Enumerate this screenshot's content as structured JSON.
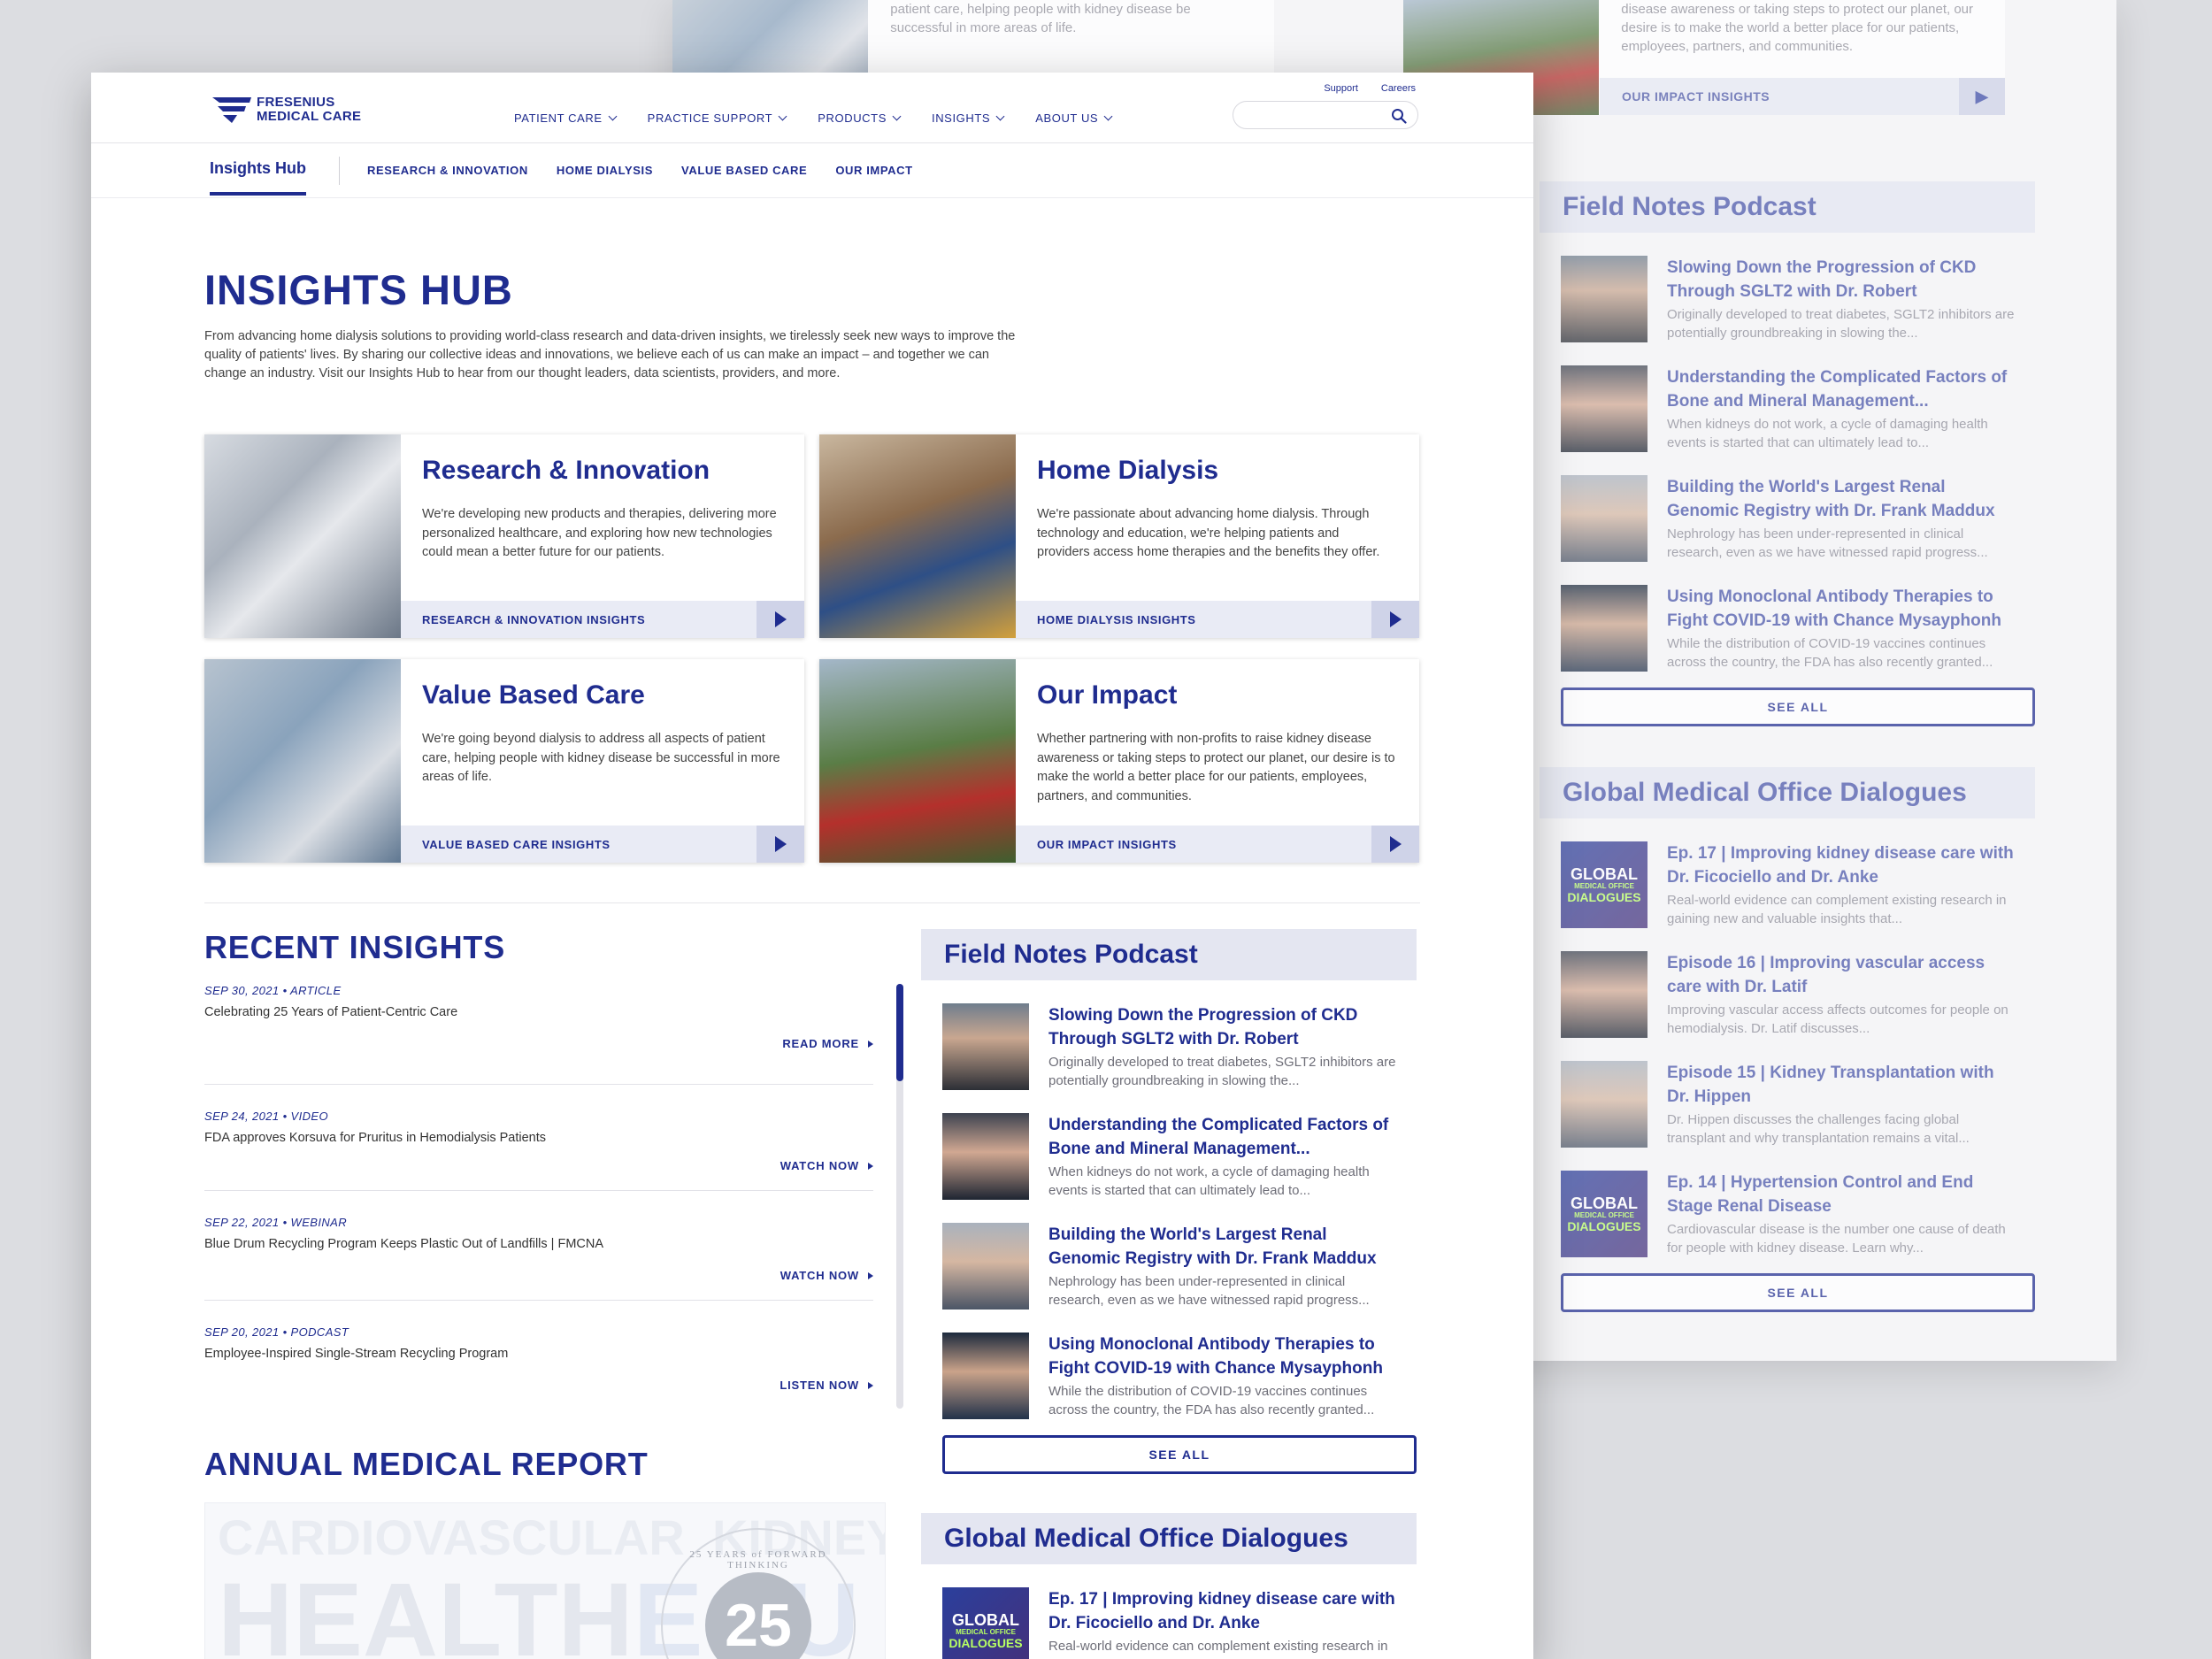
{
  "brand": {
    "line1": "FRESENIUS",
    "line2": "MEDICAL CARE",
    "color": "#1f2c8f"
  },
  "utility": {
    "support": "Support",
    "careers": "Careers"
  },
  "nav": [
    "PATIENT CARE",
    "PRACTICE SUPPORT",
    "PRODUCTS",
    "INSIGHTS",
    "ABOUT US"
  ],
  "search": {
    "placeholder": ""
  },
  "subnav": {
    "current": "Insights Hub",
    "links": [
      "RESEARCH & INNOVATION",
      "HOME DIALYSIS",
      "VALUE BASED CARE",
      "OUR IMPACT"
    ]
  },
  "hero": {
    "title": "INSIGHTS HUB",
    "description": "From advancing home dialysis solutions to providing world-class research and data-driven insights, we tirelessly seek new ways to improve the quality of patients' lives. By sharing our collective ideas and innovations, we believe each of us can make an impact – and together we can change an industry. Visit our Insights Hub to hear from our thought leaders, data scientists, providers, and more."
  },
  "cards": [
    {
      "title": "Research & Innovation",
      "body": "We're developing new products and therapies, delivering more personalized healthcare, and exploring how new technologies could mean a better future for our patients.",
      "link": "RESEARCH & INNOVATION INSIGHTS"
    },
    {
      "title": "Home Dialysis",
      "body": "We're passionate about advancing home dialysis. Through technology and education, we're helping patients and providers access home therapies and the benefits they offer.",
      "link": "HOME DIALYSIS INSIGHTS"
    },
    {
      "title": "Value Based Care",
      "body": "We're going beyond dialysis to address all aspects of patient care, helping people with kidney disease be successful in more areas of life.",
      "link": "VALUE BASED CARE INSIGHTS"
    },
    {
      "title": "Our Impact",
      "body": "Whether partnering with non-profits to raise kidney disease awareness or taking steps to protect our planet, our desire is to make the world a better place for our patients, employees, partners, and communities.",
      "link": "OUR IMPACT INSIGHTS"
    }
  ],
  "recent": {
    "title": "RECENT INSIGHTS",
    "items": [
      {
        "date": "SEP 30, 2021",
        "type": "ARTICLE",
        "headline": "Celebrating 25 Years of Patient-Centric Care",
        "action": "READ MORE"
      },
      {
        "date": "SEP 24, 2021",
        "type": "VIDEO",
        "headline": "FDA approves Korsuva for Pruritus in Hemodialysis Patients",
        "action": "WATCH NOW"
      },
      {
        "date": "SEP 22, 2021",
        "type": "WEBINAR",
        "headline": "Blue Drum Recycling Program Keeps Plastic Out of Landfills | FMCNA",
        "action": "WATCH NOW"
      },
      {
        "date": "SEP 20, 2021",
        "type": "PODCAST",
        "headline": "Employee-Inspired Single-Stream Recycling Program",
        "action": "LISTEN NOW"
      }
    ],
    "separator": "•"
  },
  "annual": {
    "title": "ANNUAL MEDICAL REPORT",
    "bg_word1": "CARDIOVASCULAR",
    "bg_word2": "KIDNEY TRANSPLANT",
    "bg_word3": "HEALTH",
    "bg_word4": "EQU",
    "seal": "25 YEARS of FORWARD THINKING",
    "seal_num": "25"
  },
  "podcast": {
    "title": "Field Notes Podcast",
    "items": [
      {
        "title": "Slowing Down the Progression of CKD Through SGLT2 with Dr. Robert",
        "desc": "Originally developed to treat diabetes, SGLT2 inhibitors are potentially groundbreaking in slowing the..."
      },
      {
        "title": "Understanding the Complicated Factors of Bone and Mineral Management...",
        "desc": "When kidneys do not work, a cycle of damaging health events is started that can ultimately lead to..."
      },
      {
        "title": "Building the World's Largest Renal Genomic Registry with Dr. Frank Maddux",
        "desc": "Nephrology has been under-represented in clinical research, even as we have witnessed rapid progress..."
      },
      {
        "title": "Using Monoclonal Antibody Therapies to Fight COVID-19 with Chance Mysayphonh",
        "desc": "While the distribution of COVID-19 vaccines continues across the country, the FDA has also recently granted..."
      }
    ],
    "see_all": "SEE ALL"
  },
  "dialogues": {
    "title": "Global Medical Office Dialogues",
    "thumb_l1": "GLOBAL",
    "thumb_l2": "MEDICAL OFFICE",
    "thumb_l3": "DIALOGUES",
    "items": [
      {
        "title": "Ep. 17 | Improving kidney disease care with Dr. Ficociello and Dr. Anke",
        "desc": "Real-world evidence can complement existing research in gaining new and valuable insights that..."
      },
      {
        "title": "Episode 16 | Improving vascular access care with Dr. Latif",
        "desc": "Improving vascular access affects outcomes for people on hemodialysis. Dr. Latif discusses..."
      },
      {
        "title": "Episode 15 | Kidney Transplantation with Dr. Hippen",
        "desc": "Dr. Hippen discusses the challenges facing global transplant and why transplantation remains a vital..."
      },
      {
        "title": "Ep. 14  | Hypertension Control and End Stage Renal Disease",
        "desc": "Cardiovascular disease is the number one cause of death for people with kidney disease. Learn why..."
      }
    ],
    "see_all": "SEE ALL"
  },
  "bg_teasers": [
    {
      "text": "patient care, helping people with kidney disease be successful in more areas of life."
    },
    {
      "text": "disease awareness or taking steps to protect our planet, our desire is to make the world a better place for our patients, employees, partners, and communities.",
      "link": "OUR IMPACT INSIGHTS"
    }
  ]
}
